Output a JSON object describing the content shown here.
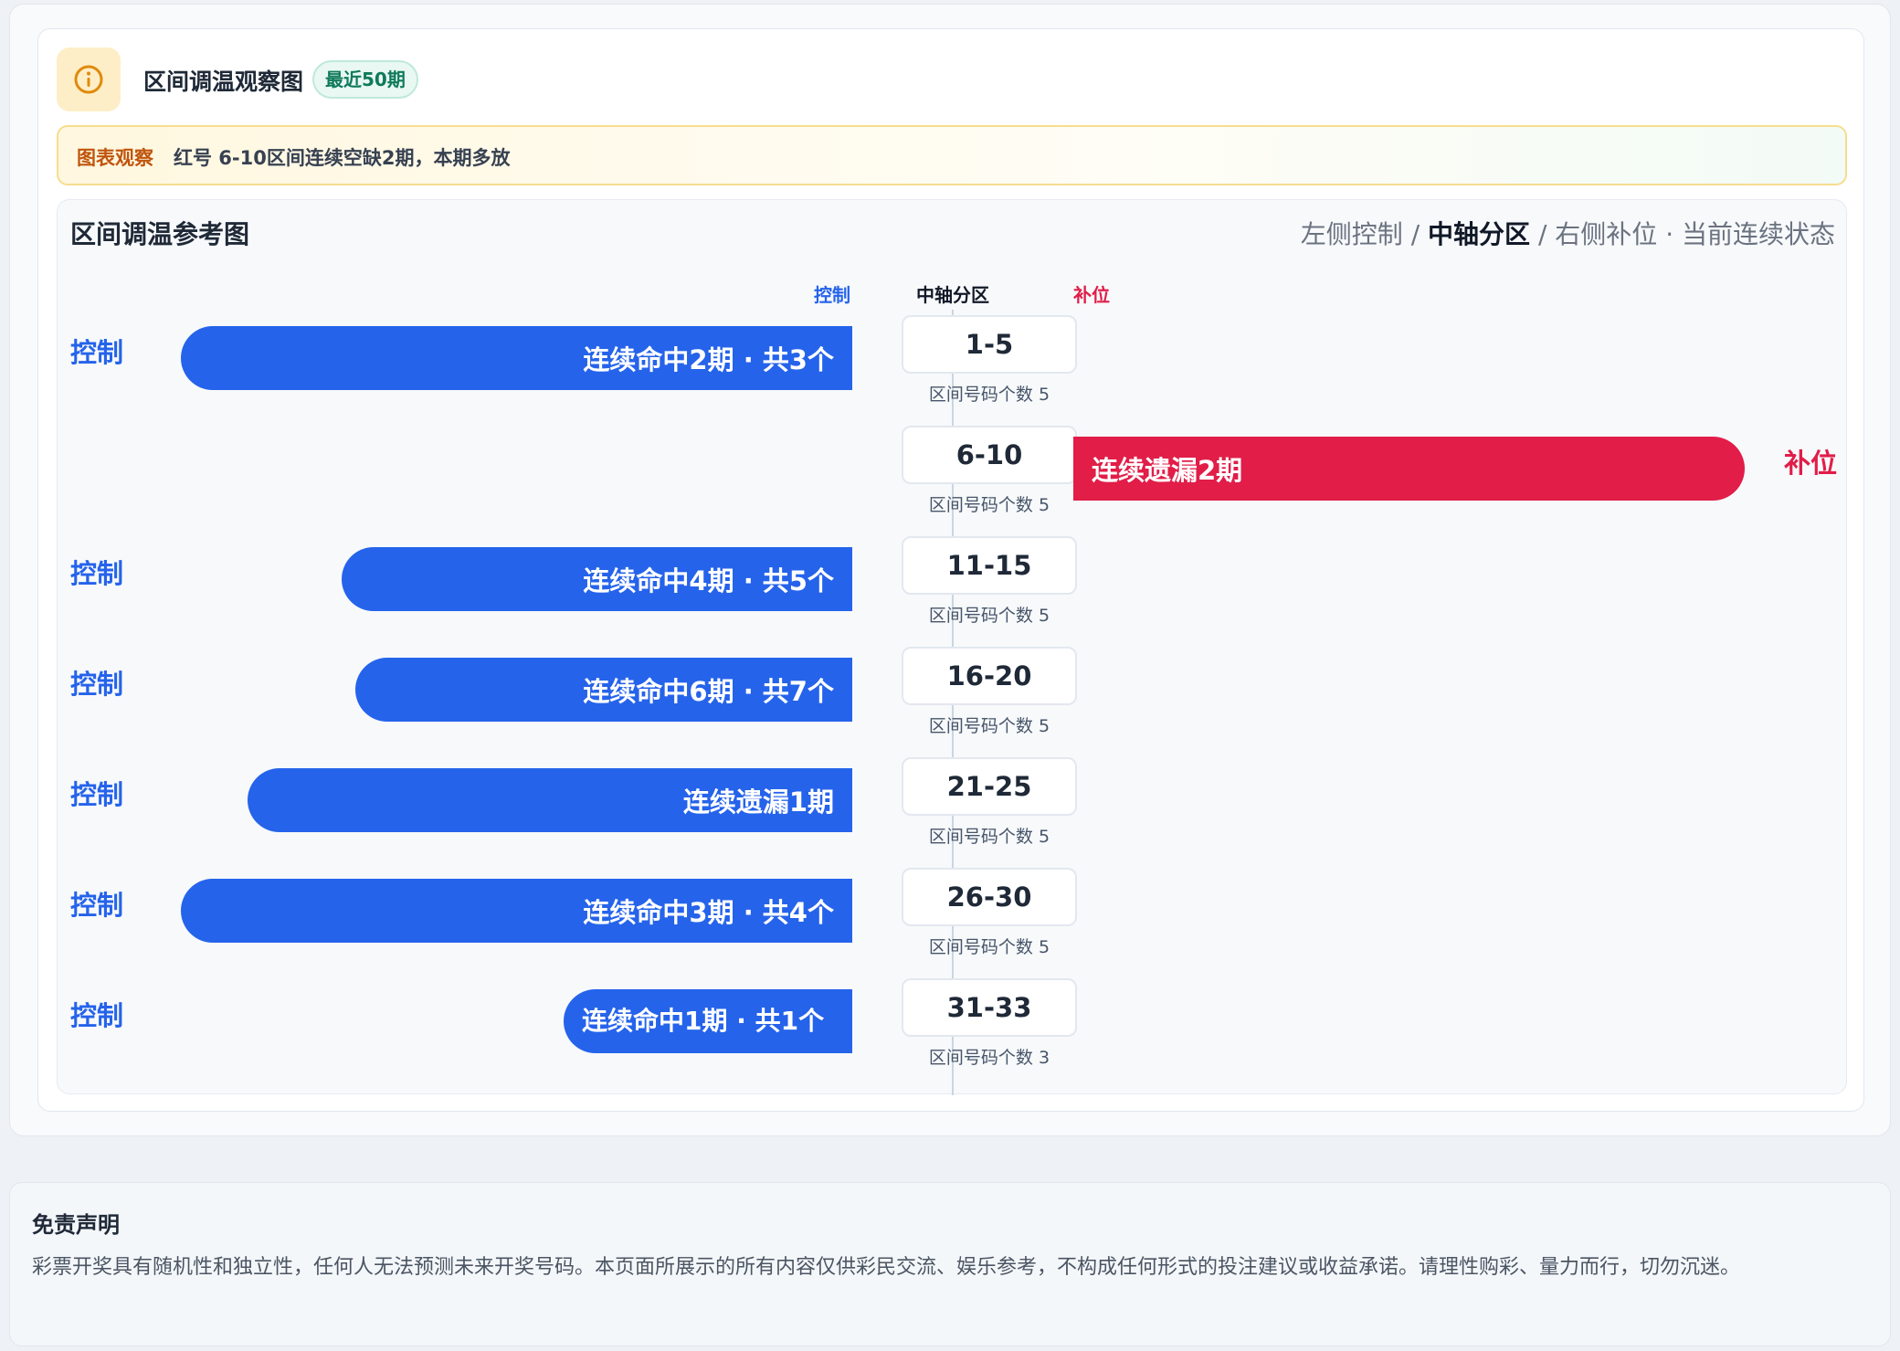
{
  "header": {
    "title": "区间调温观察图",
    "badge": "最近50期"
  },
  "observation": {
    "label": "图表观察",
    "text": "红号 6-10区间连续空缺2期，本期多放"
  },
  "panel": {
    "title": "区间调温参考图",
    "legend_left": "左侧控制 / ",
    "legend_mid": "中轴分区",
    "legend_right": " / 右侧补位 · 当前连续状态"
  },
  "columns": {
    "left": "控制",
    "middle": "中轴分区",
    "right": "补位"
  },
  "colors": {
    "control": "#2563eb",
    "fill": "#e11d48"
  },
  "chart_data": {
    "type": "bar",
    "title": "区间调温参考图",
    "categories": [
      "1-5",
      "6-10",
      "11-15",
      "16-20",
      "21-25",
      "26-30",
      "31-33"
    ],
    "rows": [
      {
        "zone": "1-5",
        "count_label": "区间号码个数 5",
        "side": "left",
        "side_label": "控制",
        "bar_text": "连续命中2期 · 共3个",
        "magnitude": 1.0
      },
      {
        "zone": "6-10",
        "count_label": "区间号码个数 5",
        "side": "right",
        "side_label": "补位",
        "bar_text": "连续遗漏2期",
        "magnitude": 1.0
      },
      {
        "zone": "11-15",
        "count_label": "区间号码个数 5",
        "side": "left",
        "side_label": "控制",
        "bar_text": "连续命中4期 · 共5个",
        "magnitude": 0.76
      },
      {
        "zone": "16-20",
        "count_label": "区间号码个数 5",
        "side": "left",
        "side_label": "控制",
        "bar_text": "连续命中6期 · 共7个",
        "magnitude": 0.74
      },
      {
        "zone": "21-25",
        "count_label": "区间号码个数 5",
        "side": "left",
        "side_label": "控制",
        "bar_text": "连续遗漏1期",
        "magnitude": 0.9
      },
      {
        "zone": "26-30",
        "count_label": "区间号码个数 5",
        "side": "left",
        "side_label": "控制",
        "bar_text": "连续命中3期 · 共4个",
        "magnitude": 1.0
      },
      {
        "zone": "31-33",
        "count_label": "区间号码个数 3",
        "side": "left",
        "side_label": "控制",
        "bar_text": "连续命中1期 · 共1个",
        "magnitude": 0.43
      }
    ]
  },
  "disclaimer": {
    "title": "免责声明",
    "text": "彩票开奖具有随机性和独立性，任何人无法预测未来开奖号码。本页面所展示的所有内容仅供彩民交流、娱乐参考，不构成任何形式的投注建议或收益承诺。请理性购彩、量力而行，切勿沉迷。"
  }
}
